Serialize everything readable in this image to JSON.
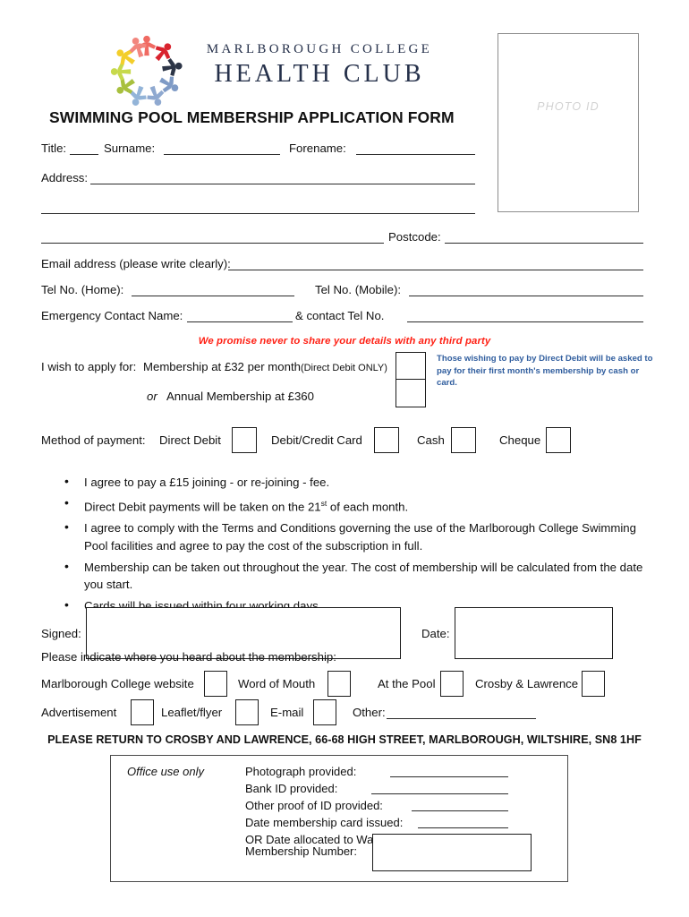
{
  "document": {
    "title": "SWIMMING POOL MEMBERSHIP APPLICATION FORM"
  },
  "logo": {
    "line1": "MARLBOROUGH COLLEGE",
    "line2": "HEALTH CLUB",
    "mark_name": "circle-of-people-logo",
    "figure_colors": [
      "#e8453c",
      "#f2a0a0",
      "#e02f3c",
      "#3b4a63",
      "#7e96c4",
      "#8fb0d8",
      "#a6bf3f",
      "#c5d94a",
      "#f2cc2e"
    ],
    "text_color": "#25304a"
  },
  "photo_id": {
    "label": "PHOTO ID"
  },
  "fields": {
    "title_label": "Title:",
    "surname_label": "Surname:",
    "forename_label": "Forename:",
    "address_label": "Address:",
    "postcode_label": "Postcode:",
    "email_label_pre": "Email address (",
    "email_label_bold": "please write clearly",
    "email_label_post": "):",
    "tel_home_label": "Tel No. (Home):",
    "tel_mobile_label": "Tel No. (Mobile):",
    "emergency_name_label": "Emergency Contact Name:",
    "emergency_tel_label": "& contact Tel No."
  },
  "privacy_notice": "We promise never to share your details with any third party",
  "membership": {
    "intro": "I wish to apply for:",
    "option1_pre": "Membership at ",
    "option1_price": "£32",
    "option1_post": " per month",
    "option1_note": "(Direct Debit ONLY)",
    "option2_italic": "or",
    "option2_pre": "Annual Membership at ",
    "option2_price": "£360",
    "direct_debit_note_line1": "Those wishing to pay by Direct Debit will be asked to",
    "direct_debit_note_line2": "pay for their first month's membership by cash or card.",
    "note_color": "#2f5d9e"
  },
  "payment": {
    "label": "Method of payment:",
    "options": [
      {
        "label": "Direct Debit"
      },
      {
        "label": "Debit/Credit Card"
      },
      {
        "label": "Cash"
      },
      {
        "label": "Cheque"
      }
    ]
  },
  "terms": [
    {
      "text": "I agree to pay a £15 joining - or re-joining - fee."
    },
    {
      "pre": "Direct Debit payments will be taken on the 21",
      "sup": "st",
      "post": " of each month."
    },
    {
      "text": "I agree to comply with the Terms and Conditions governing the use of the Marlborough College Swimming Pool facilities and agree to pay the cost of the subscription in full."
    },
    {
      "text": "Membership can be taken out throughout the year. The cost of membership will be calculated from the date you start."
    },
    {
      "text": "Cards will be issued within four working days."
    }
  ],
  "signature": {
    "signed_label": "Signed:",
    "date_label": "Date:"
  },
  "referral": {
    "prompt": "Please indicate where you heard about the membership:",
    "row1": [
      {
        "label": "Marlborough College website"
      },
      {
        "label": "Word of Mouth"
      },
      {
        "label": "At the Pool"
      },
      {
        "label": "Crosby & Lawrence"
      }
    ],
    "row2": [
      {
        "label": "Advertisement"
      },
      {
        "label": "Leaflet/flyer"
      },
      {
        "label": "E-mail"
      }
    ],
    "other_label": "Other:"
  },
  "return_instruction": "PLEASE RETURN TO CROSBY AND LAWRENCE, 66-68 HIGH STREET, MARLBOROUGH, WILTSHIRE, SN8 1HF",
  "office_use": {
    "heading": "Office use only",
    "rows": [
      {
        "label": "Photograph provided:"
      },
      {
        "label": "Bank ID provided:"
      },
      {
        "label": "Other proof of ID provided:"
      },
      {
        "label": "Date membership card issued:"
      }
    ],
    "waiting_bold": "OR",
    "waiting_rest": " Date allocated to Waiting List:",
    "membership_number_label": "Membership Number:"
  }
}
